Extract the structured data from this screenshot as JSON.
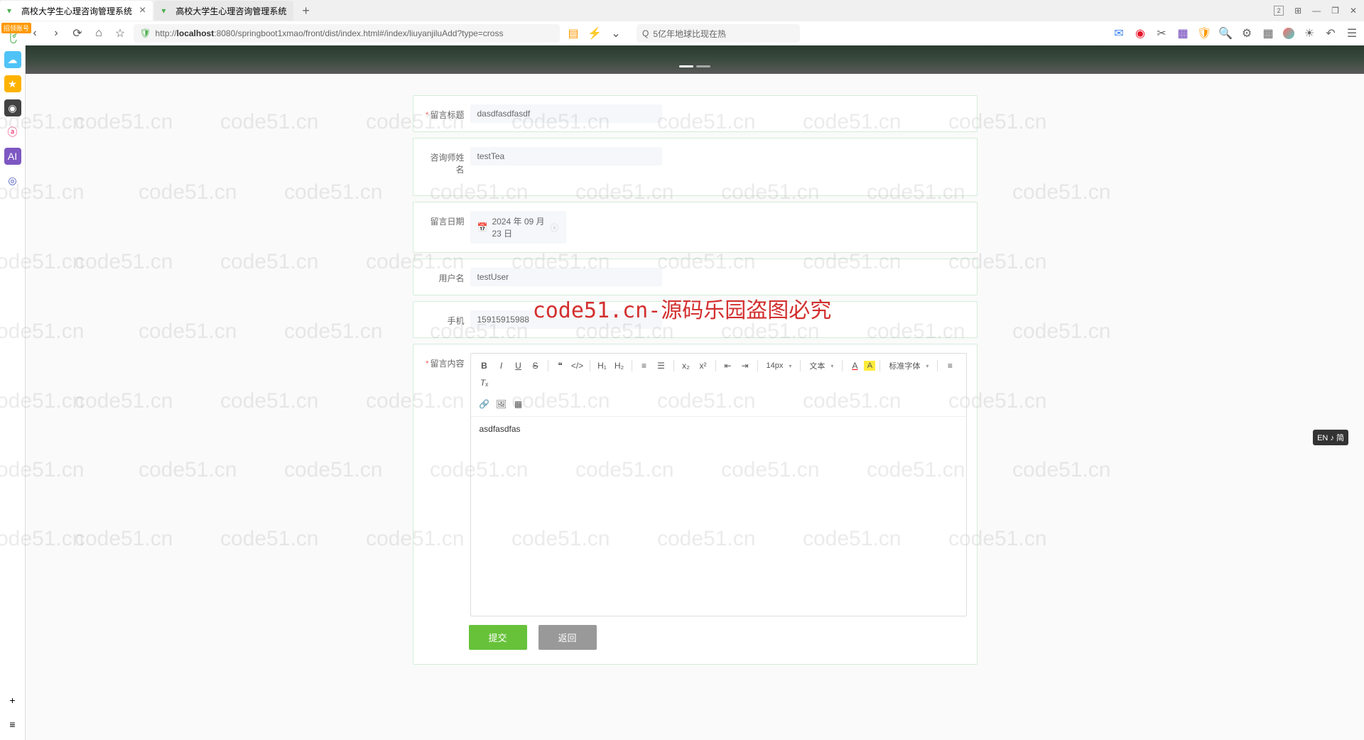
{
  "browser": {
    "tabs": [
      {
        "title": "高校大学生心理咨询管理系统",
        "active": true
      },
      {
        "title": "高校大学生心理咨询管理系统",
        "active": false
      }
    ],
    "url_prefix": "http://",
    "url_host": "localhost",
    "url_path": ":8080/springboot1xmao/front/dist/index.html#/index/liuyanjiluAdd?type=cross",
    "search_placeholder": "5亿年地球比现在热",
    "window_badge": "2",
    "orange_badge": "招领账号"
  },
  "form": {
    "title_label": "留言标题",
    "title_value": "dasdfasdfasdf",
    "consultant_label": "咨询师姓名",
    "consultant_value": "testTea",
    "date_label": "留言日期",
    "date_value": "2024 年 09 月 23 日",
    "username_label": "用户名",
    "username_value": "testUser",
    "phone_label": "手机",
    "phone_value": "15915915988",
    "content_label": "留言内容",
    "content_value": "asdfasdfas"
  },
  "editor_toolbar": {
    "size": "14px",
    "block": "文本",
    "font": "标准字体"
  },
  "buttons": {
    "submit": "提交",
    "back": "返回"
  },
  "watermark": "code51.cn",
  "center_warning": "code51.cn-源码乐园盗图必究",
  "lang_badge": "EN ♪ 简"
}
